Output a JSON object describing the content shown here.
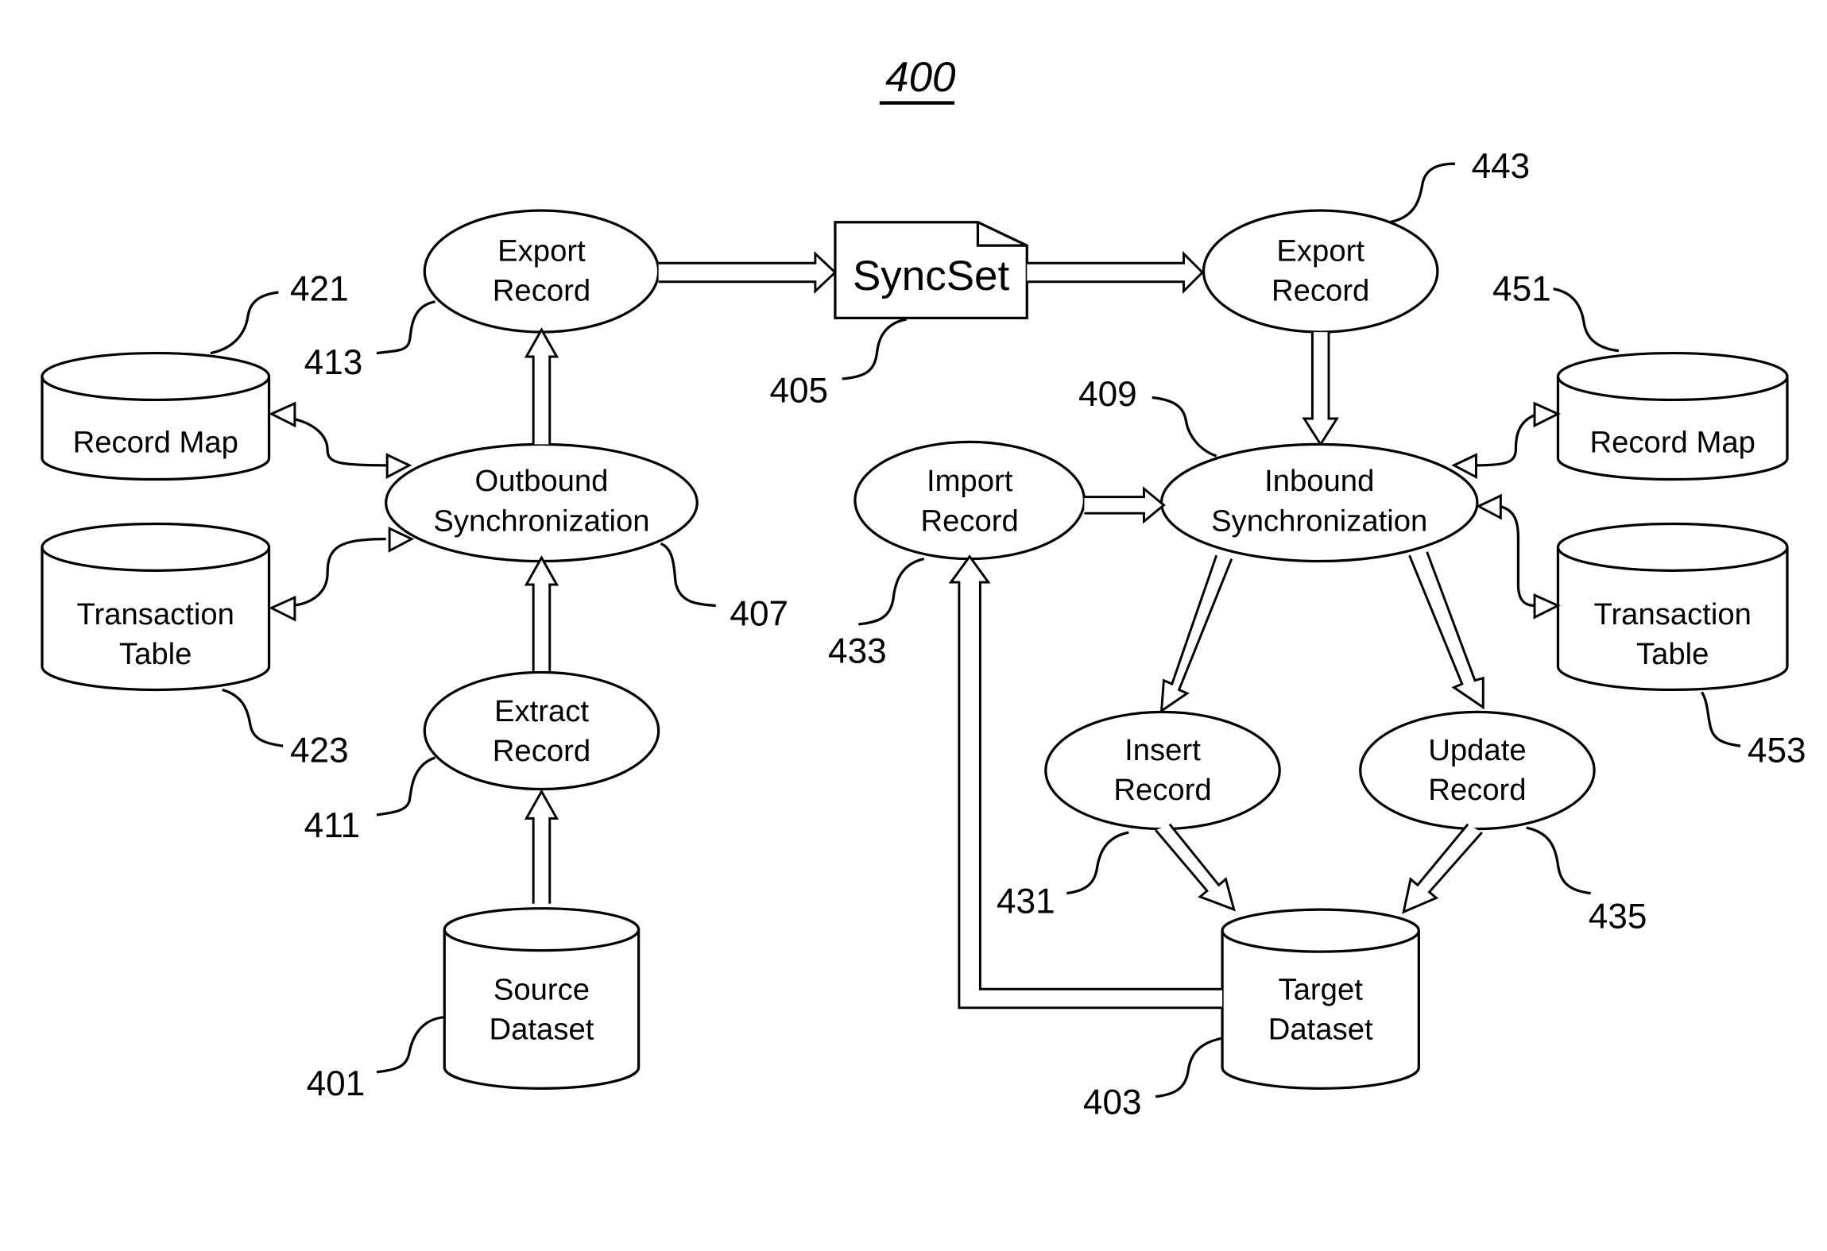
{
  "figure": {
    "number": "400"
  },
  "nodes": {
    "export_record_out": {
      "line1": "Export",
      "line2": "Record",
      "ref": "413"
    },
    "outbound_sync": {
      "line1": "Outbound",
      "line2": "Synchronization",
      "ref": "407"
    },
    "extract_record": {
      "line1": "Extract",
      "line2": "Record",
      "ref": "411"
    },
    "source_dataset": {
      "line1": "Source",
      "line2": "Dataset",
      "ref": "401"
    },
    "record_map_left": {
      "line1": "Record Map",
      "ref": "421"
    },
    "transaction_table_left": {
      "line1": "Transaction",
      "line2": "Table",
      "ref": "423"
    },
    "syncset": {
      "line1": "SyncSet",
      "ref": "405"
    },
    "export_record_in": {
      "line1": "Export",
      "line2": "Record",
      "ref": "443"
    },
    "inbound_sync": {
      "line1": "Inbound",
      "line2": "Synchronization",
      "ref": "409"
    },
    "import_record": {
      "line1": "Import",
      "line2": "Record",
      "ref": "433"
    },
    "record_map_right": {
      "line1": "Record Map",
      "ref": "451"
    },
    "transaction_table_right": {
      "line1": "Transaction",
      "line2": "Table",
      "ref": "453"
    },
    "insert_record": {
      "line1": "Insert",
      "line2": "Record",
      "ref": "431"
    },
    "update_record": {
      "line1": "Update",
      "line2": "Record",
      "ref": "435"
    },
    "target_dataset": {
      "line1": "Target",
      "line2": "Dataset",
      "ref": "403"
    }
  }
}
